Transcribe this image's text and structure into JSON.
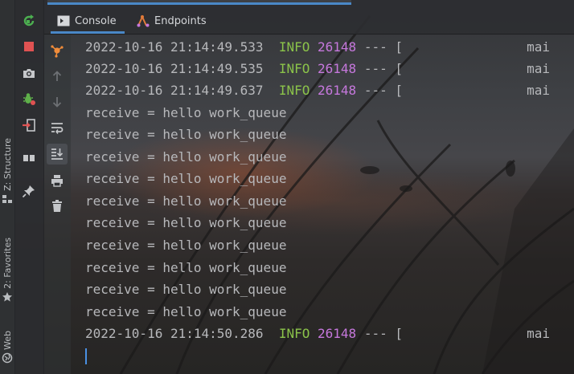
{
  "tabs": [
    {
      "label": "Console",
      "icon": "console-icon",
      "active": true
    },
    {
      "label": "Endpoints",
      "icon": "endpoints-icon",
      "active": false
    }
  ],
  "side_stripe": {
    "structure": "Z: Structure",
    "favorites": "2: Favorites",
    "web": "Web"
  },
  "toolbar_left": [
    {
      "name": "rerun-icon",
      "color": "#4caf50"
    },
    {
      "name": "stop-icon",
      "color": "#e05252"
    },
    {
      "name": "camera-icon",
      "color": "#c5c7ca"
    },
    {
      "name": "debug-bug-icon",
      "color": "#5fb04a"
    },
    {
      "name": "exit-icon",
      "color": "#e05252"
    },
    {
      "name": "layout-icon",
      "color": "#c5c7ca"
    },
    {
      "name": "pin-icon",
      "color": "#c5c7ca"
    }
  ],
  "toolbar_right": [
    {
      "name": "network-node-icon",
      "color": "#f08c3a"
    },
    {
      "name": "arrow-up-icon",
      "color": "#6d7074"
    },
    {
      "name": "arrow-down-icon",
      "color": "#6d7074"
    },
    {
      "name": "soft-wrap-icon",
      "color": "#c5c7ca"
    },
    {
      "name": "scroll-to-end-icon",
      "color": "#c5c7ca"
    },
    {
      "name": "print-icon",
      "color": "#c5c7ca"
    },
    {
      "name": "trash-icon",
      "color": "#c5c7ca"
    }
  ],
  "console": {
    "log_lines": [
      {
        "timestamp": "2022-10-16 21:14:49.533",
        "level": "INFO",
        "pid": "26148",
        "sep": "--- [",
        "thread": "mai"
      },
      {
        "timestamp": "2022-10-16 21:14:49.535",
        "level": "INFO",
        "pid": "26148",
        "sep": "--- [",
        "thread": "mai"
      },
      {
        "timestamp": "2022-10-16 21:14:49.637",
        "level": "INFO",
        "pid": "26148",
        "sep": "--- [",
        "thread": "mai"
      }
    ],
    "receive_lines": [
      "receive = hello work_queue",
      "receive = hello work_queue",
      "receive = hello work_queue",
      "receive = hello work_queue",
      "receive = hello work_queue",
      "receive = hello work_queue",
      "receive = hello work_queue",
      "receive = hello work_queue",
      "receive = hello work_queue",
      "receive = hello work_queue"
    ],
    "last_log": {
      "timestamp": "2022-10-16 21:14:50.286",
      "level": "INFO",
      "pid": "26148",
      "sep": "--- [",
      "thread": "mai"
    }
  },
  "colors": {
    "info": "#8bc34a",
    "pid": "#c678dd",
    "accent": "#4a88c7"
  }
}
